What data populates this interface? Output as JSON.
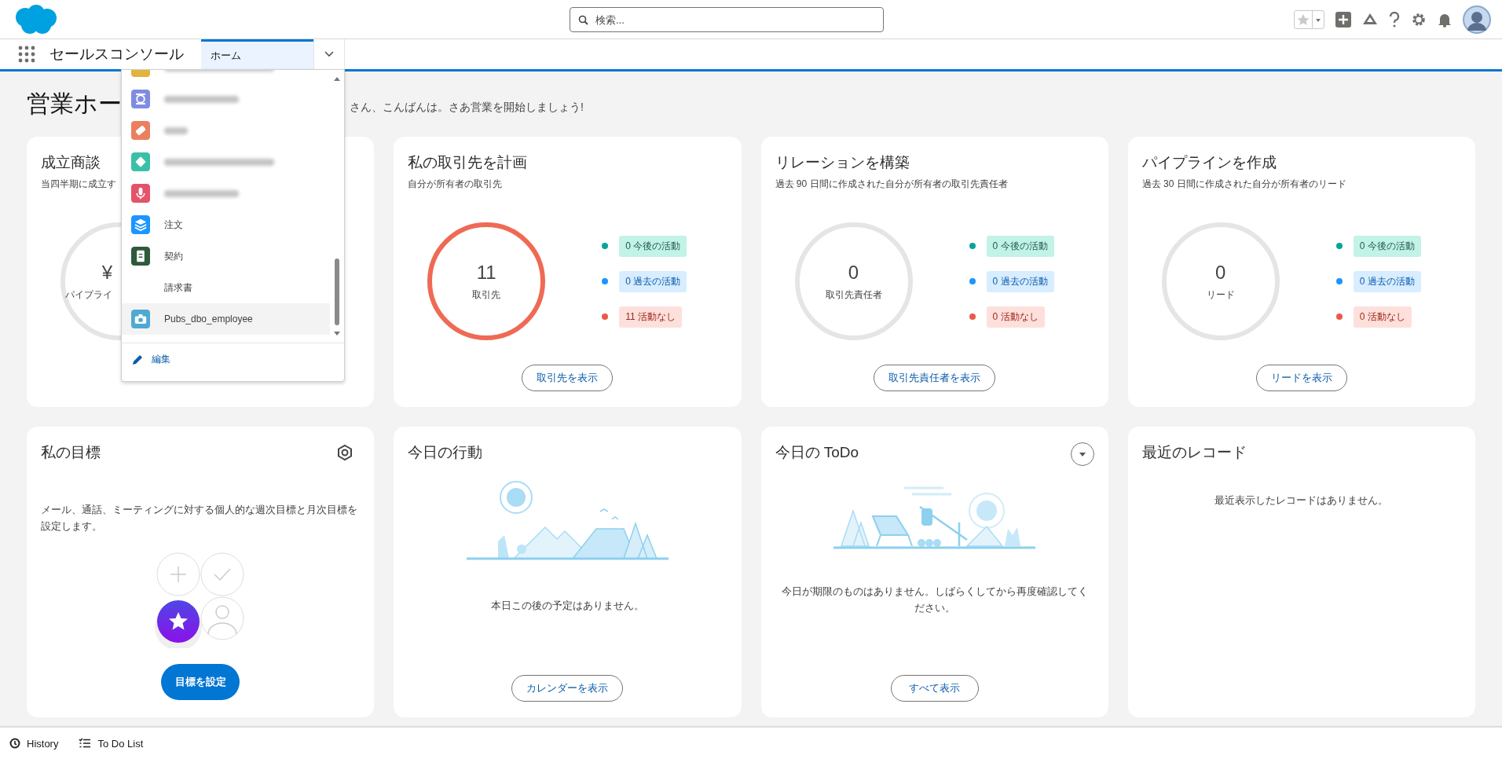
{
  "header": {
    "search": {
      "placeholder": "検索..."
    }
  },
  "nav": {
    "app_name": "セールスコンソール",
    "tabs": [
      {
        "label": "ホーム",
        "selected": true
      }
    ]
  },
  "page": {
    "title": "営業ホー",
    "greeting": "さん、こんばんは。さあ営業を開始しましょう!"
  },
  "cards": [
    {
      "kind": "ring",
      "title": "成立商談",
      "subtitle": "当四半期に成立す",
      "clipped": true,
      "ring": {
        "value": "¥",
        "label": "パイプライ",
        "color": "#e5e5e5"
      }
    },
    {
      "kind": "ring",
      "title": "私の取引先を計画",
      "subtitle": "自分が所有者の取引先",
      "clipped": false,
      "ring": {
        "value": "11",
        "label": "取引先",
        "color": "#ef6a55"
      },
      "legend": [
        {
          "kind": "upcoming",
          "color": "#06a59a",
          "label": "0 今後の活動"
        },
        {
          "kind": "past",
          "color": "#1b96ff",
          "label": "0 過去の活動"
        },
        {
          "kind": "none",
          "color": "#ea5a4a",
          "label": "11 活動なし"
        }
      ],
      "button": {
        "label": "取引先を表示"
      }
    },
    {
      "kind": "ring",
      "title": "リレーションを構築",
      "subtitle": "過去 90 日間に作成された自分が所有者の取引先責任者",
      "clipped": false,
      "ring": {
        "value": "0",
        "label": "取引先責任者",
        "color": "#e5e5e5"
      },
      "legend": [
        {
          "kind": "upcoming",
          "color": "#06a59a",
          "label": "0 今後の活動"
        },
        {
          "kind": "past",
          "color": "#1b96ff",
          "label": "0 過去の活動"
        },
        {
          "kind": "none",
          "color": "#ea5a4a",
          "label": "0 活動なし"
        }
      ],
      "button": {
        "label": "取引先責任者を表示"
      }
    },
    {
      "kind": "ring",
      "title": "パイプラインを作成",
      "subtitle": "過去 30 日間に作成された自分が所有者のリード",
      "clipped": false,
      "ring": {
        "value": "0",
        "label": "リード",
        "color": "#e5e5e5"
      },
      "legend": [
        {
          "kind": "upcoming",
          "color": "#06a59a",
          "label": "0 今後の活動"
        },
        {
          "kind": "past",
          "color": "#1b96ff",
          "label": "0 過去の活動"
        },
        {
          "kind": "none",
          "color": "#ea5a4a",
          "label": "0 活動なし"
        }
      ],
      "button": {
        "label": "リードを表示"
      }
    },
    {
      "kind": "goals",
      "title": "私の目標",
      "description": "メール、通話、ミーティングに対する個人的な週次目標と月次目標を設定します。",
      "button": {
        "label": "目標を設定"
      }
    },
    {
      "kind": "events",
      "title": "今日の行動",
      "message": "本日この後の予定はありません。",
      "button": {
        "label": "カレンダーを表示"
      }
    },
    {
      "kind": "todo",
      "title": "今日の ToDo",
      "message": "今日が期限のものはありません。しばらくしてから再度確認してください。",
      "button": {
        "label": "すべて表示"
      }
    },
    {
      "kind": "records",
      "title": "最近のレコード",
      "message": "最近表示したレコードはありません。"
    }
  ],
  "dropdown": {
    "items": [
      {
        "kind": "crown",
        "color": "#e2b33f",
        "highlighted": false
      },
      {
        "kind": "scale",
        "color": "#7f8de1",
        "highlighted": false
      },
      {
        "kind": "ticket",
        "color": "#ea8060",
        "highlighted": false
      },
      {
        "kind": "diamond",
        "color": "#3bc0a8",
        "highlighted": false
      },
      {
        "kind": "mic",
        "color": "#e5536b",
        "highlighted": false
      },
      {
        "kind": "layers",
        "color": "#1b96ff",
        "label": "注文",
        "highlighted": false
      },
      {
        "kind": "document",
        "color": "#2e5a3c",
        "label": "契約",
        "highlighted": false
      },
      {
        "kind": "none",
        "label": "請求書",
        "highlighted": false
      },
      {
        "kind": "camera",
        "color": "#4ea9d3",
        "label": "Pubs_dbo_employee",
        "highlighted": true
      }
    ],
    "footer": "編集"
  },
  "utility_bar": {
    "items": [
      {
        "kind": "history",
        "label": "History"
      },
      {
        "kind": "todo",
        "label": "To Do List"
      }
    ]
  }
}
